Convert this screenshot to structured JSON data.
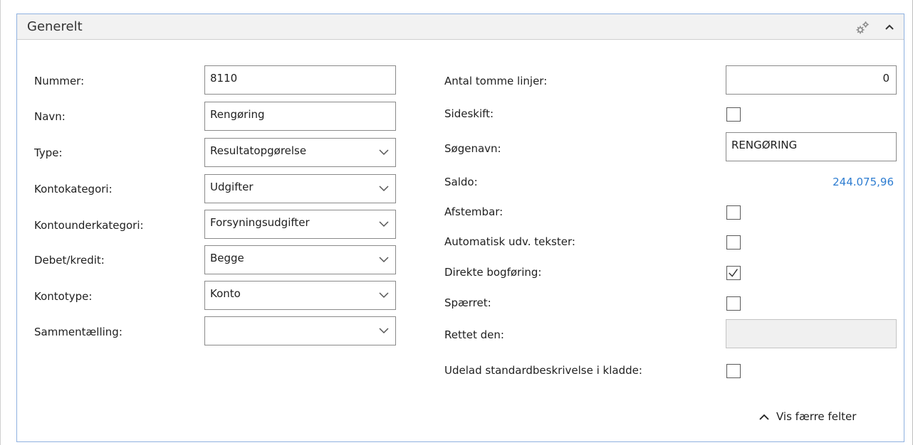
{
  "section": {
    "title": "Generelt",
    "show_fewer_label": "Vis færre felter"
  },
  "left": {
    "nummer": {
      "label": "Nummer:",
      "value": "8110"
    },
    "navn": {
      "label": "Navn:",
      "value": "Rengøring"
    },
    "type": {
      "label": "Type:",
      "value": "Resultatopgørelse"
    },
    "kontokategori": {
      "label": "Kontokategori:",
      "value": "Udgifter"
    },
    "kontounderkategori": {
      "label": "Kontounderkategori:",
      "value": "Forsyningsudgifter"
    },
    "debet_kredit": {
      "label": "Debet/kredit:",
      "value": "Begge"
    },
    "kontotype": {
      "label": "Kontotype:",
      "value": "Konto"
    },
    "sammentaelling": {
      "label": "Sammentælling:",
      "value": ""
    }
  },
  "right": {
    "antal_tomme_linjer": {
      "label": "Antal tomme linjer:",
      "value": "0"
    },
    "sideskift": {
      "label": "Sideskift:",
      "checked": false
    },
    "soegenavn": {
      "label": "Søgenavn:",
      "value": "RENGØRING"
    },
    "saldo": {
      "label": "Saldo:",
      "value": "244.075,96"
    },
    "afstembar": {
      "label": "Afstembar:",
      "checked": false
    },
    "automatisk_udv_tekster": {
      "label": "Automatisk udv. tekster:",
      "checked": false
    },
    "direkte_bogfoering": {
      "label": "Direkte bogføring:",
      "checked": true
    },
    "spaerret": {
      "label": "Spærret:",
      "checked": false
    },
    "rettet_den": {
      "label": "Rettet den:",
      "value": ""
    },
    "udelad_standardbeskrivelse": {
      "label": "Udelad standardbeskrivelse i kladde:",
      "checked": false
    }
  },
  "icons": {
    "gear": "gear-icon",
    "collapse": "chevron-up-icon",
    "select_arrow": "chevron-down-icon",
    "checkmark": "checkmark-icon"
  },
  "colors": {
    "panel_border": "#8fb1e0",
    "link": "#2e7dd1",
    "header_bg": "#f2f2f2"
  }
}
